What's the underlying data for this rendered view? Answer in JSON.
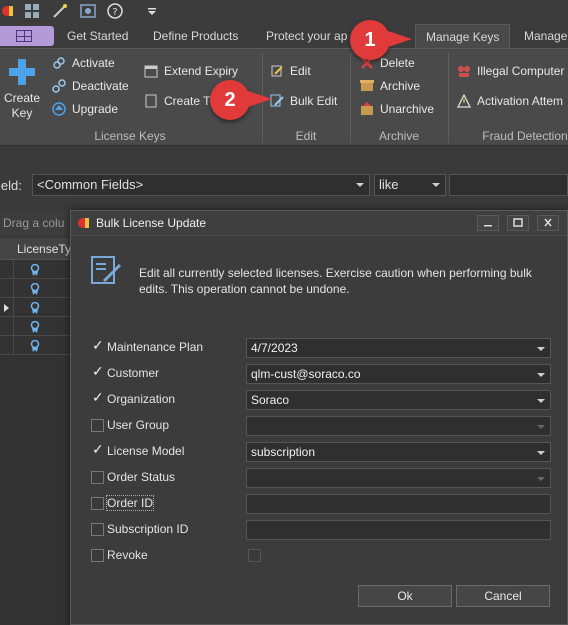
{
  "colors": {
    "accent": "#b49ad8",
    "badge": "#e03a3a",
    "dialog_bg": "#3c3c3c"
  },
  "tabs": [
    {
      "label": "Get Started"
    },
    {
      "label": "Define Products"
    },
    {
      "label": "Protect your ap"
    },
    {
      "label": "Manage Keys"
    },
    {
      "label": "Manage"
    }
  ],
  "ribbon": {
    "license_keys": {
      "label": "License Keys",
      "create_key": "Create\nKey",
      "activate": "Activate",
      "deactivate": "Deactivate",
      "upgrade": "Upgrade",
      "extend_expiry": "Extend Expiry",
      "create_t": "Create T"
    },
    "edit": {
      "label": "Edit",
      "edit": "Edit",
      "bulk_edit": "Bulk Edit"
    },
    "archive": {
      "label": "Archive",
      "delete": "Delete",
      "archive": "Archive",
      "unarchive": "Unarchive"
    },
    "fraud": {
      "label": "Fraud Detection",
      "illegal": "Illegal Computer",
      "activation": "Activation Attem"
    }
  },
  "filter": {
    "field_label": "ield:",
    "field_value": "<Common Fields>",
    "op_value": "like"
  },
  "grid": {
    "drag_text": "Drag a colu",
    "column": "LicenseTy"
  },
  "dialog": {
    "title": "Bulk License Update",
    "info": "Edit all currently selected licenses. Exercise caution when performing bulk edits. This operation cannot be undone.",
    "rows": [
      {
        "label": "Maintenance Plan",
        "checked": true,
        "value": "4/7/2023"
      },
      {
        "label": "Customer",
        "checked": true,
        "value": "qlm-cust@soraco.co"
      },
      {
        "label": "Organization",
        "checked": true,
        "value": "Soraco"
      },
      {
        "label": "User Group",
        "checked": false,
        "value": ""
      },
      {
        "label": "License Model",
        "checked": true,
        "value": "subscription"
      },
      {
        "label": "Order Status",
        "checked": false,
        "value": ""
      },
      {
        "label": "Order ID",
        "checked": false,
        "value": ""
      },
      {
        "label": "Subscription ID",
        "checked": false,
        "value": ""
      },
      {
        "label": "Revoke",
        "checked": false,
        "value": ""
      }
    ],
    "ok": "Ok",
    "cancel": "Cancel"
  },
  "callouts": {
    "one": "1",
    "two": "2"
  },
  "checkmark": "✓"
}
